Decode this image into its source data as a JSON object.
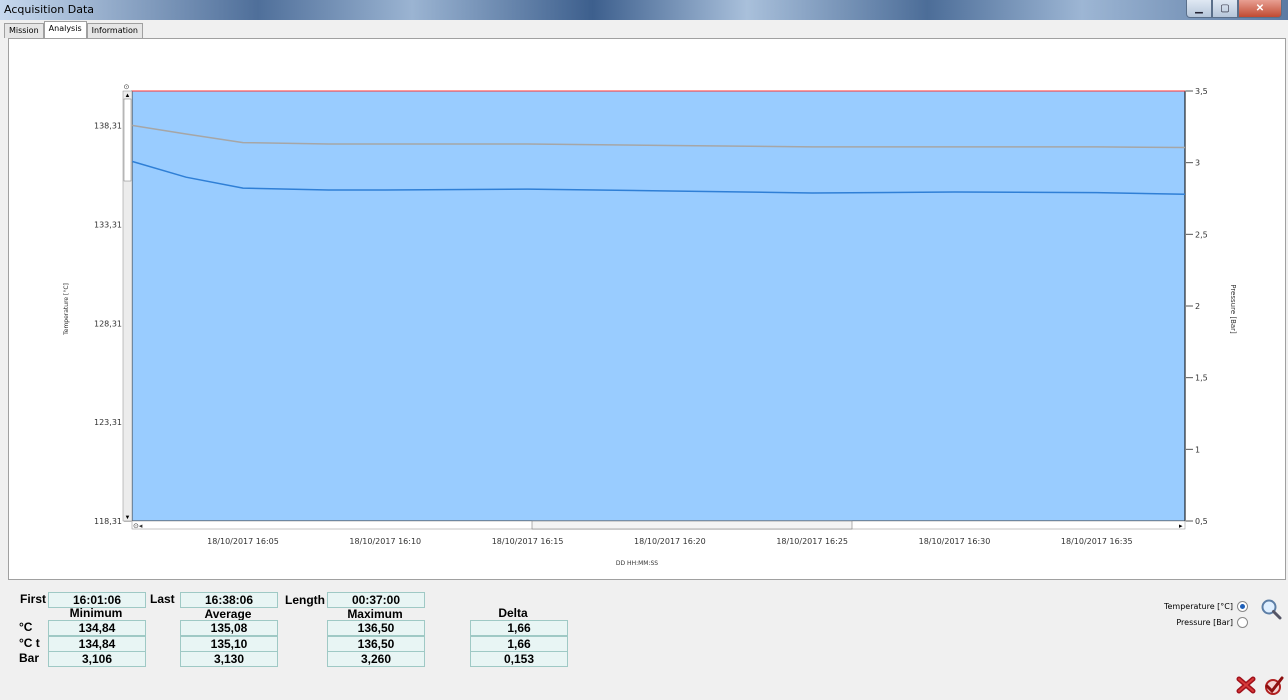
{
  "window": {
    "title": "Acquisition Data"
  },
  "tabs": [
    {
      "label": "Mission"
    },
    {
      "label": "Analysis"
    },
    {
      "label": "Information"
    }
  ],
  "chart_data": {
    "type": "line",
    "ylabel": "Temperature [°C]",
    "y2label": "Pressure [Bar]",
    "xlabel": "DD HH:MM:SS",
    "y_ticks": [
      "138,31",
      "133,31",
      "128,31",
      "123,31",
      "118,31"
    ],
    "y2_ticks": [
      "3,5",
      "3",
      "2,5",
      "2",
      "1,5",
      "1",
      "0,5"
    ],
    "x_ticks": [
      "18/10/2017 16:05",
      "18/10/2017 16:10",
      "18/10/2017 16:15",
      "18/10/2017 16:20",
      "18/10/2017 16:25",
      "18/10/2017 16:30",
      "18/10/2017 16:35"
    ],
    "ylim": [
      118.31,
      140.06
    ],
    "y2lim": [
      0.5,
      3.5
    ],
    "x_minutes_range": [
      "16:01:06",
      "16:38:06"
    ],
    "plot_background": "#99ccff",
    "series": [
      {
        "color": "#2f7fd6",
        "axis": "left",
        "x": [
          "16:01:06",
          "16:03",
          "16:05",
          "16:08",
          "16:10",
          "16:15",
          "16:20",
          "16:25",
          "16:30",
          "16:35",
          "16:38:06"
        ],
        "values": [
          136.5,
          135.7,
          135.15,
          135.05,
          135.05,
          135.1,
          135.0,
          134.9,
          134.95,
          134.92,
          134.84
        ]
      },
      {
        "color": "#a6a6a6",
        "axis": "right",
        "x": [
          "16:01:06",
          "16:03",
          "16:05",
          "16:08",
          "16:10",
          "16:15",
          "16:20",
          "16:25",
          "16:30",
          "16:35",
          "16:38:06"
        ],
        "values": [
          3.26,
          3.2,
          3.14,
          3.13,
          3.13,
          3.13,
          3.12,
          3.11,
          3.11,
          3.11,
          3.106
        ]
      }
    ]
  },
  "stats": {
    "first_label": "First",
    "first_value": "16:01:06",
    "last_label": "Last",
    "last_value": "16:38:06",
    "length_label": "Length",
    "length_value": "00:37:00",
    "col_minimum": "Minimum",
    "col_average": "Average",
    "col_maximum": "Maximum",
    "col_delta": "Delta",
    "rows": [
      {
        "label": "°C",
        "min": "134,84",
        "avg": "135,08",
        "max": "136,50",
        "delta": "1,66"
      },
      {
        "label": "°C t",
        "min": "134,84",
        "avg": "135,10",
        "max": "136,50",
        "delta": "1,66"
      },
      {
        "label": "Bar",
        "min": "3,106",
        "avg": "3,130",
        "max": "3,260",
        "delta": "0,153"
      }
    ]
  },
  "options": {
    "temperature_label": "Temperature [°C]",
    "temperature_selected": true,
    "pressure_label": "Pressure [Bar]",
    "pressure_selected": false
  },
  "icons": [
    "zoom-icon",
    "cancel-icon",
    "confirm-icon"
  ]
}
